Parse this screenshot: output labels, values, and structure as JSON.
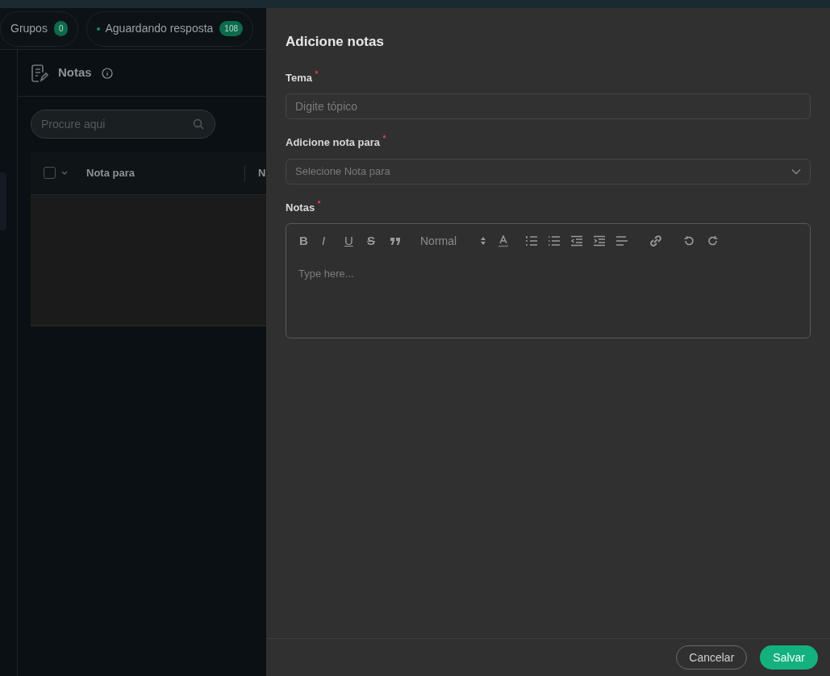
{
  "tabs": [
    {
      "label": "Grupos",
      "count": "0",
      "indicator": false
    },
    {
      "label": "Aguardando resposta",
      "count": "108",
      "indicator": true
    }
  ],
  "notes_panel": {
    "title": "Notas",
    "search": {
      "placeholder": "Procure aqui"
    },
    "table": {
      "select_all_checked": false,
      "columns": [
        "Nota para",
        "N"
      ]
    }
  },
  "drawer": {
    "title": "Adicione notas",
    "fields": [
      {
        "kind": "input",
        "label": "Tema",
        "required": true,
        "placeholder": "Digite tópico"
      },
      {
        "kind": "select",
        "label": "Adicione nota para",
        "required": true,
        "placeholder": "Selecione Nota para"
      },
      {
        "kind": "editor",
        "label": "Notas",
        "required": true,
        "placeholder": "Type here...",
        "format_letters": [
          "B",
          "I",
          "U",
          "S"
        ],
        "block_format": "Normal"
      }
    ],
    "buttons": [
      {
        "label": "Cancelar",
        "kind": "secondary"
      },
      {
        "label": "Salvar",
        "kind": "primary"
      }
    ]
  }
}
